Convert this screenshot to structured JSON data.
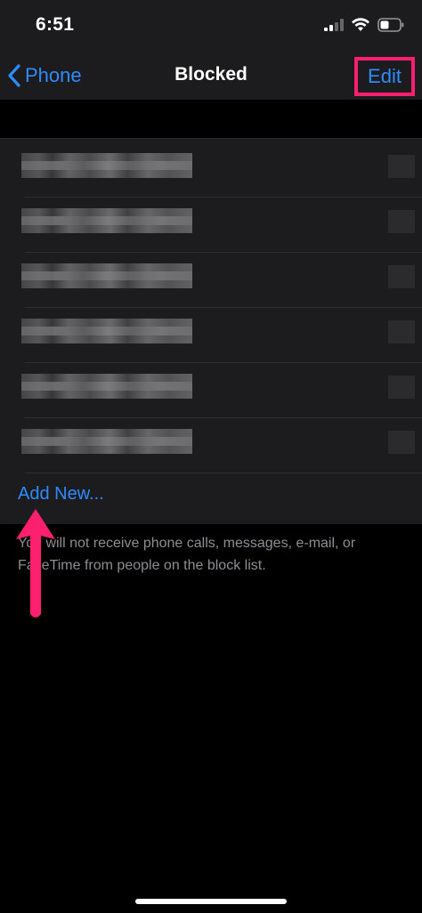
{
  "status_bar": {
    "time": "6:51",
    "icons": [
      "cellular-signal-icon",
      "wifi-icon",
      "battery-icon"
    ]
  },
  "navbar": {
    "back_label": "Phone",
    "title": "Blocked",
    "edit_label": "Edit"
  },
  "blocked_list": {
    "rows": 6
  },
  "add_new_label": "Add New...",
  "footer_note": "You will not receive phone calls, messages, e-mail, or FaceTime from people on the block list.",
  "colors": {
    "accent": "#2f8cff",
    "highlight": "#ff1f6f",
    "background": "#000000",
    "surface": "#1c1c1e",
    "secondary_text": "#8d8d92"
  }
}
